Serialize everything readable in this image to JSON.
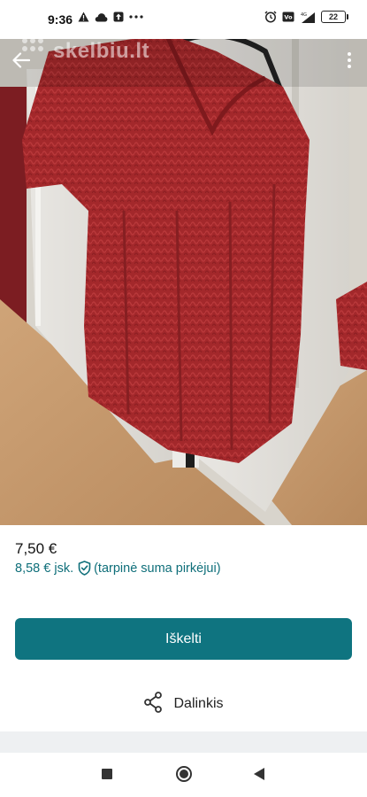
{
  "status_bar": {
    "time": "9:36",
    "battery_level": "22"
  },
  "photo": {
    "watermark": "skelbiu.lt"
  },
  "listing": {
    "price": "7,50 €",
    "buyer_price": "8,58 € jsk.",
    "buyer_note": "(tarpinė suma pirkėjui)"
  },
  "actions": {
    "promote_label": "Iškelti",
    "share_label": "Dalinkis"
  },
  "colors": {
    "accent": "#0f7480",
    "link": "#0f6f7a",
    "sweater": "#a3282b"
  }
}
